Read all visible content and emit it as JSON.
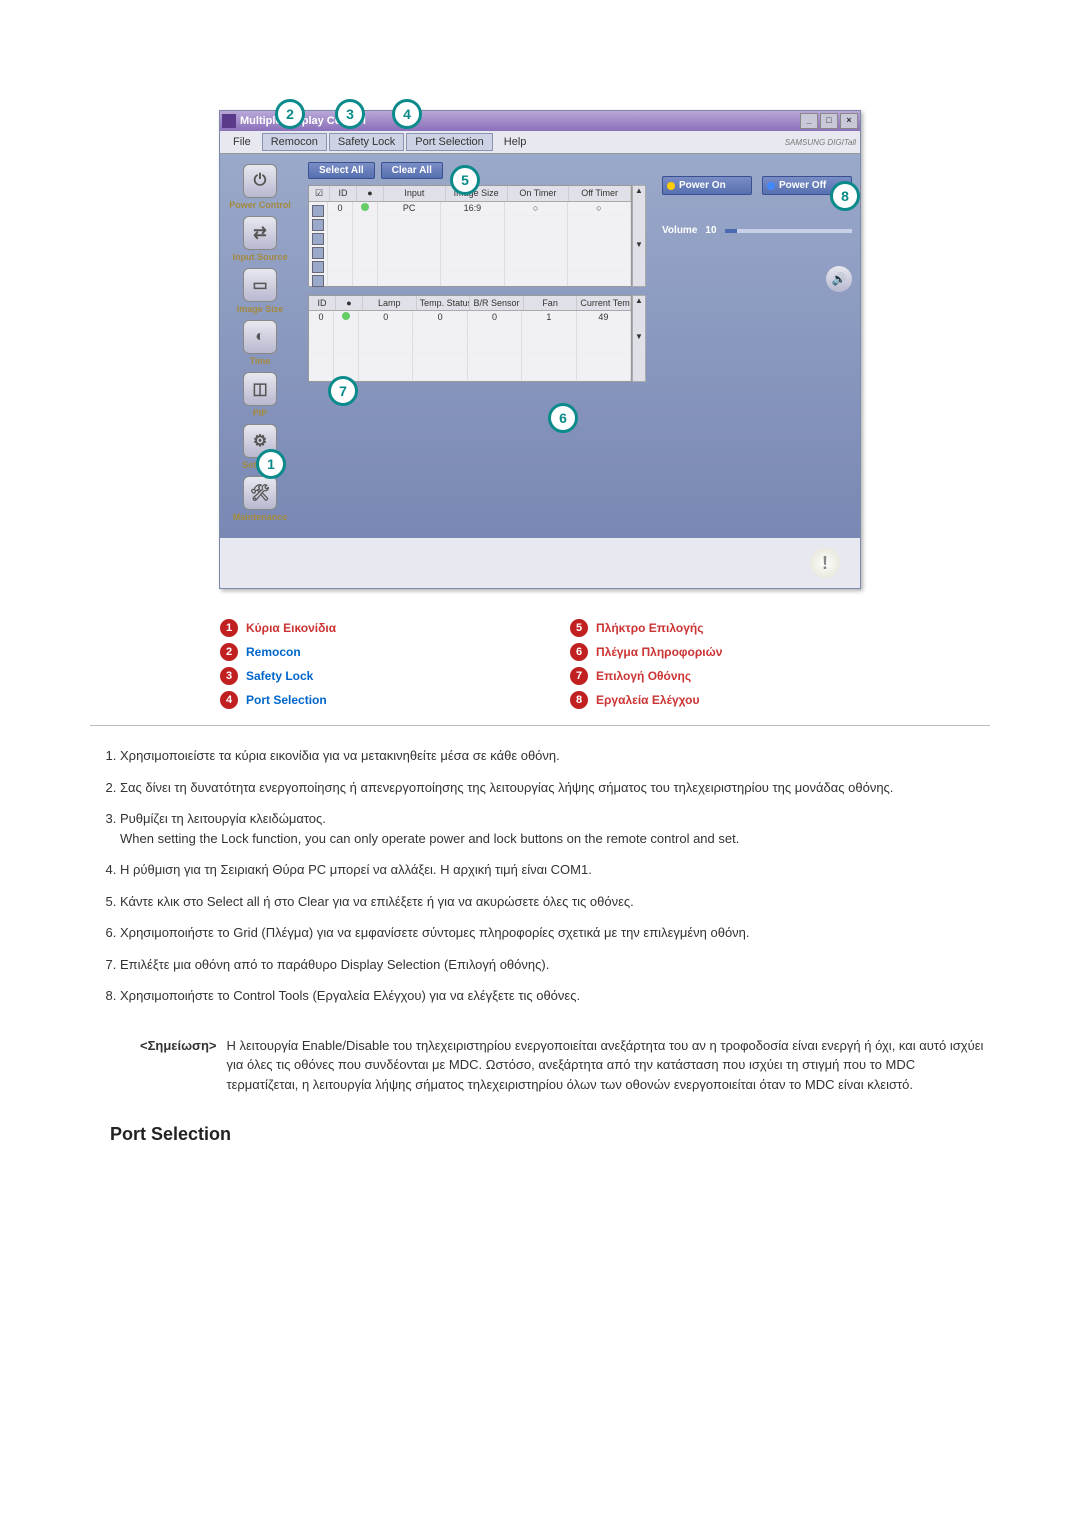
{
  "titlebar": {
    "text": "Multiple Display Control"
  },
  "menubar": {
    "file": "File",
    "remocon": "Remocon",
    "safety_lock": "Safety Lock",
    "port_selection": "Port Selection",
    "help": "Help"
  },
  "brand": "SAMSUNG DIGITall",
  "sidebar": {
    "items": [
      {
        "label": "Power Control"
      },
      {
        "label": "Input Source"
      },
      {
        "label": "Image Size"
      },
      {
        "label": "Time"
      },
      {
        "label": "PIP"
      },
      {
        "label": "Settings"
      },
      {
        "label": "Maintenance"
      }
    ]
  },
  "buttons": {
    "select_all": "Select All",
    "clear_all": "Clear All"
  },
  "grid1": {
    "headers": [
      "ID",
      "",
      "Input",
      "Image Size",
      "On Timer",
      "Off Timer"
    ],
    "row": {
      "id": "0",
      "input": "PC",
      "image_size": "16:9",
      "on_timer": "○",
      "off_timer": "○"
    }
  },
  "grid2": {
    "headers": [
      "ID",
      "",
      "Lamp",
      "Temp. Status",
      "B/R Sensor",
      "Fan",
      "Current Temp."
    ],
    "row": {
      "id": "0",
      "lamp": "0",
      "temp_status": "0",
      "br": "0",
      "fan": "1",
      "current": "49"
    }
  },
  "right": {
    "power_on": "Power On",
    "power_off": "Power Off",
    "volume_label": "Volume",
    "volume_value": "10"
  },
  "legend": [
    {
      "n": "1",
      "text": "Κύρια Εικονίδια",
      "color": "red"
    },
    {
      "n": "2",
      "text": "Remocon",
      "color": "blue"
    },
    {
      "n": "3",
      "text": "Safety Lock",
      "color": "blue"
    },
    {
      "n": "4",
      "text": "Port Selection",
      "color": "blue"
    },
    {
      "n": "5",
      "text": "Πλήκτρο Επιλογής",
      "color": "red"
    },
    {
      "n": "6",
      "text": "Πλέγμα Πληροφοριών",
      "color": "red"
    },
    {
      "n": "7",
      "text": "Επιλογή Οθόνης",
      "color": "red"
    },
    {
      "n": "8",
      "text": "Εργαλεία Ελέγχου",
      "color": "red"
    }
  ],
  "notes": [
    "Χρησιμοποιείστε τα κύρια εικονίδια για να μετακινηθείτε μέσα σε κάθε οθόνη.",
    "Σας δίνει τη δυνατότητα ενεργοποίησης ή απενεργοποίησης της λειτουργίας λήψης σήματος του τηλεχειριστηρίου της μονάδας οθόνης.",
    "Ρυθμίζει τη λειτουργία κλειδώματος.\nWhen setting the Lock function, you can only operate power and lock buttons on the remote control and set.",
    "Η ρύθμιση για τη Σειριακή Θύρα PC μπορεί να αλλάξει. Η αρχική τιμή είναι COM1.",
    "Κάντε κλικ στο Select all ή στο Clear για να επιλέξετε ή για να ακυρώσετε όλες τις οθόνες.",
    "Χρησιμοποιήστε το Grid (Πλέγμα) για να εμφανίσετε σύντομες πληροφορίες σχετικά με την επιλεγμένη οθόνη.",
    "Επιλέξτε μια οθόνη από το παράθυρο Display Selection (Επιλογή οθόνης).",
    "Χρησιμοποιήστε το Control Tools (Εργαλεία Ελέγχου) για να ελέγξετε τις οθόνες."
  ],
  "note_label": "<Σημείωση>",
  "note_body": "Η λειτουργία Enable/Disable του τηλεχειριστηρίου ενεργοποιείται ανεξάρτητα του αν η τροφοδοσία είναι ενεργή ή όχι, και αυτό ισχύει για όλες τις οθόνες που συνδέονται με MDC. Ωστόσο, ανεξάρτητα από την κατάσταση που ισχύει τη στιγμή που το MDC τερματίζεται, η λειτουργία λήψης σήματος τηλεχειριστηρίου όλων των οθονών ενεργοποιείται όταν το MDC είναι κλειστό.",
  "section_title": "Port Selection",
  "callouts": {
    "c1": "1",
    "c2": "2",
    "c3": "3",
    "c4": "4",
    "c5": "5",
    "c6": "6",
    "c7": "7",
    "c8": "8"
  }
}
